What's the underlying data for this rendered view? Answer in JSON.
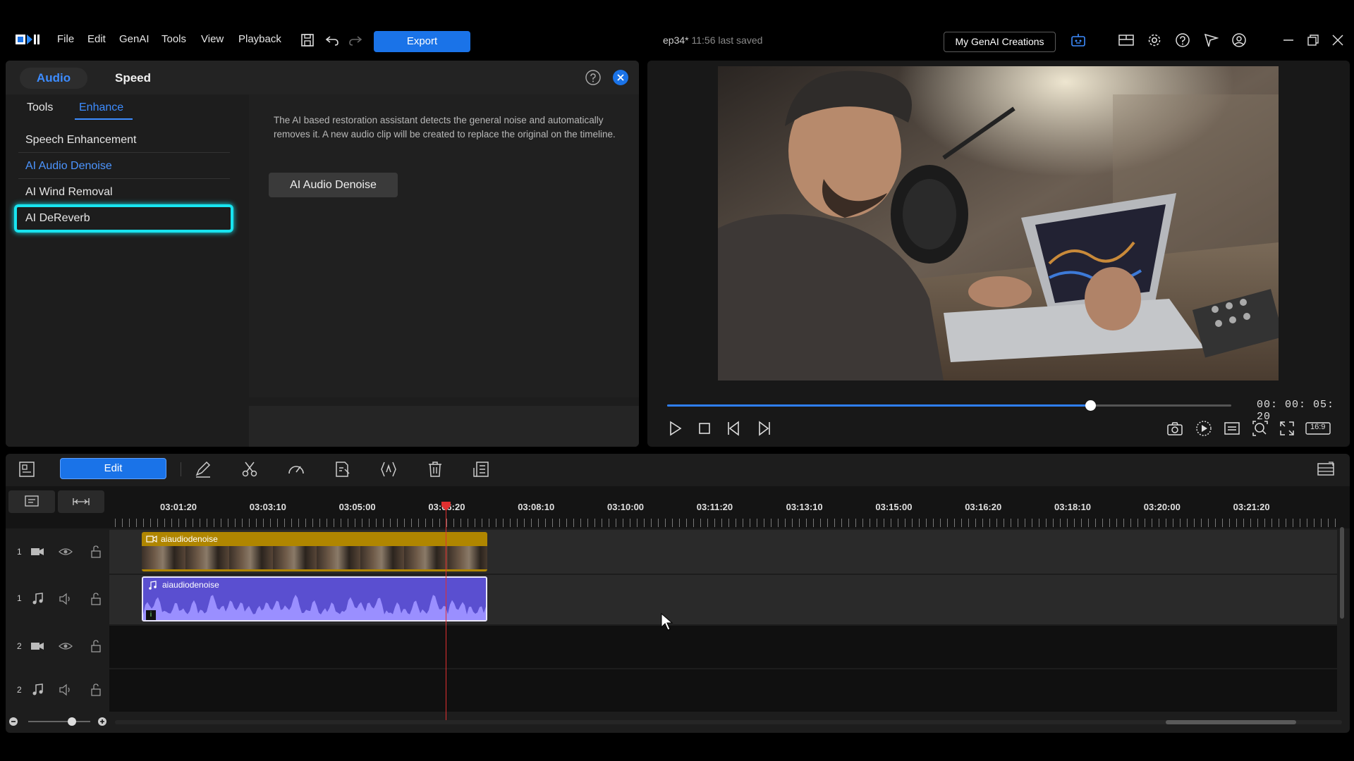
{
  "app": {
    "menu": [
      "File",
      "Edit",
      "GenAI",
      "Tools",
      "View",
      "Playback"
    ],
    "export_label": "Export",
    "project_name": "ep34*",
    "saved_status": "11:56 last saved",
    "genai_label": "My GenAI Creations",
    "accent": "#1a73e8"
  },
  "panel": {
    "tabs": [
      "Audio",
      "Speed"
    ],
    "active_tab": "Audio",
    "subtabs": [
      "Tools",
      "Enhance"
    ],
    "active_subtab": "Enhance",
    "features": [
      "Speech Enhancement",
      "AI Audio Denoise",
      "AI Wind Removal",
      "AI DeReverb"
    ],
    "active_feature": "AI Audio Denoise",
    "highlighted_feature": "AI DeReverb",
    "description": "The AI based restoration assistant detects the general noise and automatically removes it. A new audio clip will be created to replace the original on the timeline.",
    "action_label": "AI Audio Denoise",
    "highlight_color": "#18e4f0"
  },
  "preview": {
    "timecode": "00: 00: 05: 20",
    "progress": 0.75,
    "aspect_label": "16:9"
  },
  "timeline": {
    "edit_label": "Edit",
    "ruler_labels": [
      "03:01:20",
      "03:03:10",
      "03:05:00",
      "03:06:20",
      "03:08:10",
      "03:10:00",
      "03:11:20",
      "03:13:10",
      "03:15:00",
      "03:16:20",
      "03:18:10",
      "03:20:00",
      "03:21:20"
    ],
    "tracks": [
      {
        "num": "1",
        "type": "video"
      },
      {
        "num": "1",
        "type": "audio"
      },
      {
        "num": "2",
        "type": "video"
      },
      {
        "num": "2",
        "type": "audio"
      }
    ],
    "video_clip_name": "aiaudiodenoise",
    "audio_clip_name": "aiaudiodenoise",
    "video_clip_color": "#b08600",
    "audio_clip_color": "#5a4fd0",
    "zoom_level": 0.7
  }
}
